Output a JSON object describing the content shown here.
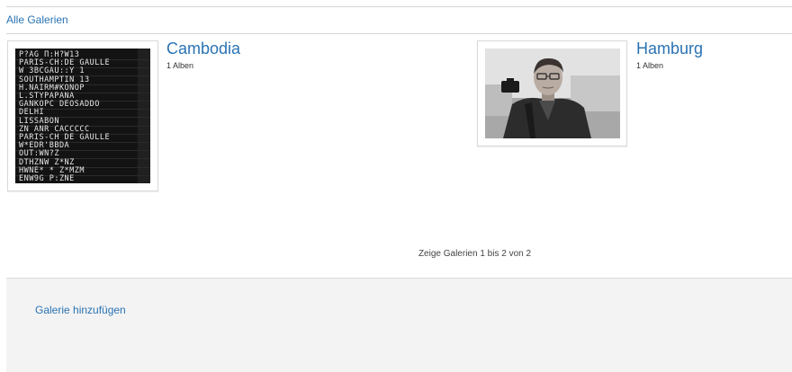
{
  "breadcrumb": {
    "label": "Alle Galerien"
  },
  "galleries": [
    {
      "title": "Cambodia",
      "count": "1 Alben"
    },
    {
      "title": "Hamburg",
      "count": "1 Alben"
    }
  ],
  "board_rows": [
    "P?AG  Π:H?W13",
    "PARIS-CH:DE GAULLE",
    "W 3BCGAU::Y 1",
    "SOUTHAMPTIN  13",
    "H.NAIRM#KONOP",
    "L.STYPAPANA",
    "GANKOPC DEOSADDO",
    "DELHI",
    "LISSABON",
    "ZN ANR CACCCCC",
    "PARIS-CH DE GAULLE",
    "W*EDR'BBDA",
    "OUT:WN?Z",
    "DTHZNW Z*NZ",
    "HWNE* * Z*MZM",
    "ENW9G  P:ZNE"
  ],
  "pager": {
    "text": "Zeige Galerien 1 bis 2 von 2"
  },
  "footer": {
    "add_label": "Galerie hinzufügen"
  },
  "colors": {
    "link": "#2a73b3",
    "footer_bg": "#f3f3f3",
    "rule": "#d6d6d6"
  }
}
